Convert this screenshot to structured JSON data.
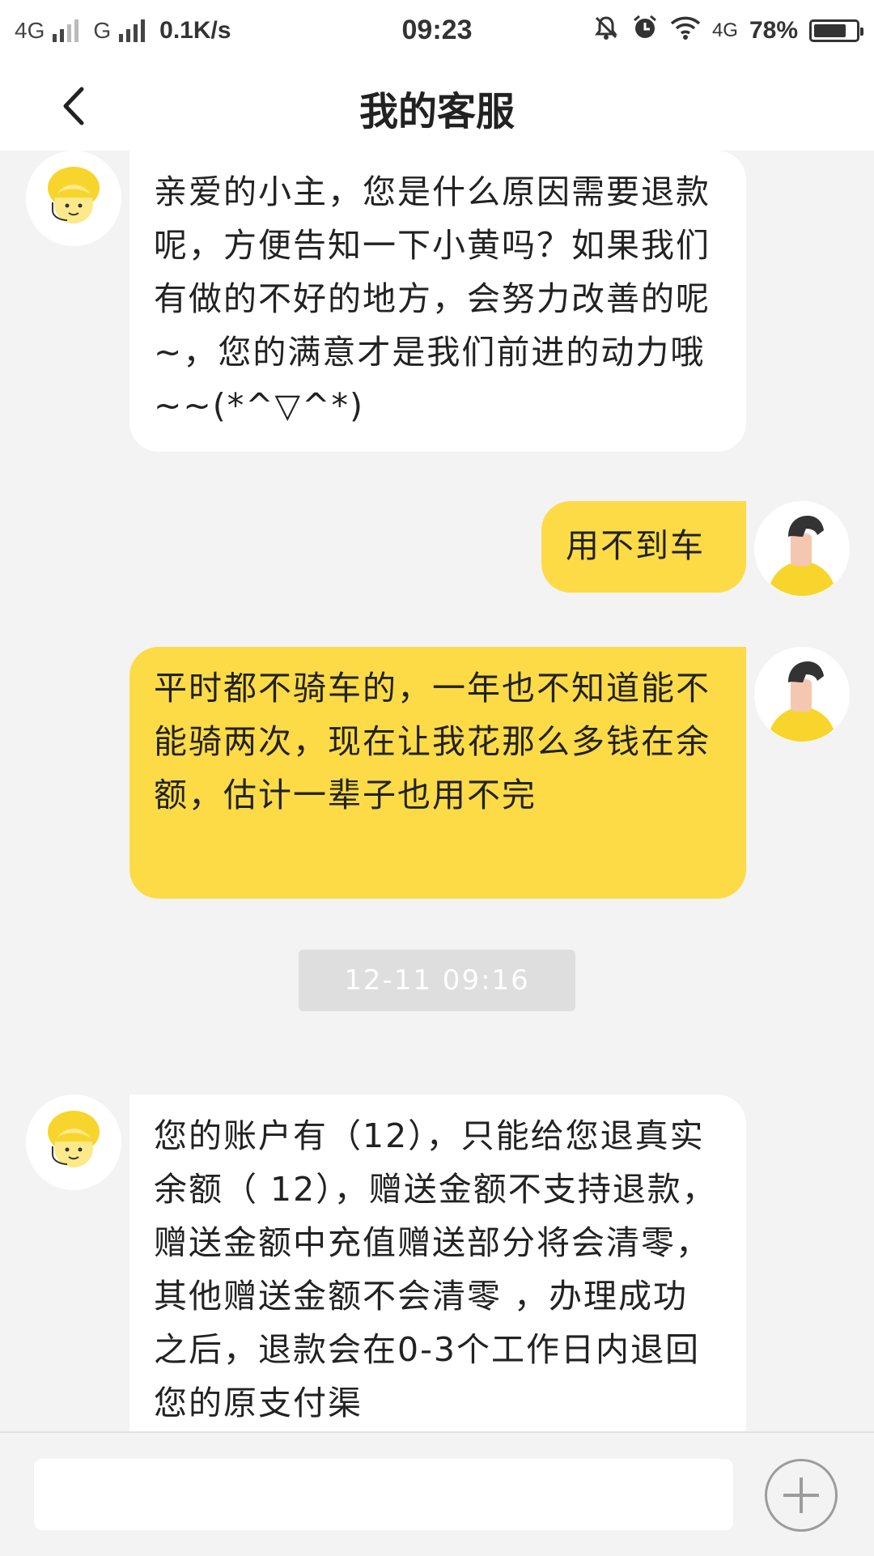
{
  "status_bar": {
    "network_1": "4G",
    "network_2": "G",
    "speed": "0.1K/s",
    "time": "09:23",
    "network_3": "4G",
    "battery_text": "78%",
    "battery_level": 0.78
  },
  "header": {
    "title": "我的客服",
    "back_icon": "chevron-left-icon"
  },
  "messages": [
    {
      "sender": "agent",
      "avatar_icon": "customer-service-avatar-icon",
      "text": "亲爱的小主，您是什么原因需要退款呢，方便告知一下小黄吗？如果我们有做的不好的地方，会努力改善的呢~，您的满意才是我们前进的动力哦~~(*^▽^*)"
    },
    {
      "sender": "user",
      "avatar_icon": "user-avatar-icon",
      "text": "用不到车"
    },
    {
      "sender": "user",
      "avatar_icon": "user-avatar-icon",
      "text": "平时都不骑车的，一年也不知道能不能骑两次，现在让我花那么多钱在余额，估计一辈子也用不完"
    },
    {
      "sender": "agent",
      "avatar_icon": "customer-service-avatar-icon",
      "text": "您的账户有（12），只能给您退真实余额（ 12），赠送金额不支持退款，赠送金额中充值赠送部分将会清零，其他赠送金额不会清零 ，办理成功之后，退款会在0-3个工作日内退回您的原支付渠"
    }
  ],
  "timestamp": "12-11 09:16",
  "input_bar": {
    "placeholder": "",
    "add_icon": "plus-circle-icon"
  },
  "colors": {
    "accent": "#fcdb47",
    "background": "#f3f3f3",
    "agent_bubble": "#ffffff"
  }
}
